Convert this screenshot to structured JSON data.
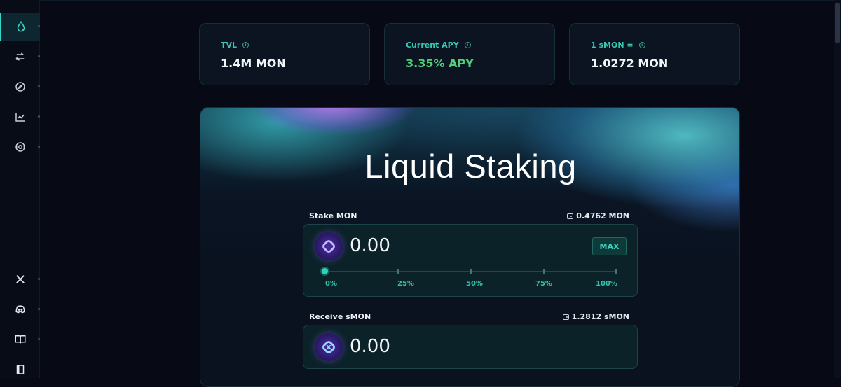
{
  "sidebar": {
    "items": [
      {
        "icon": "droplet-icon",
        "active": true
      },
      {
        "icon": "swap-icon",
        "active": false
      },
      {
        "icon": "compass-icon",
        "active": false
      },
      {
        "icon": "chart-line-icon",
        "active": false
      },
      {
        "icon": "eye-icon",
        "active": false
      }
    ],
    "footer": [
      {
        "icon": "x-icon"
      },
      {
        "icon": "discord-icon"
      },
      {
        "icon": "book-icon"
      },
      {
        "icon": "document-icon"
      }
    ]
  },
  "stats": [
    {
      "label": "TVL",
      "value": "1.4M MON",
      "color": "#f2f5f8"
    },
    {
      "label": "Current APY",
      "value": "3.35% APY",
      "color": "#4fd07a"
    },
    {
      "label": "1 sMON =",
      "value": "1.0272 MON",
      "color": "#f2f5f8"
    }
  ],
  "main": {
    "title": "Liquid Staking",
    "stake": {
      "label": "Stake MON",
      "balance": "0.4762 MON",
      "amount": "0.00",
      "max_label": "MAX",
      "slider_value": 0,
      "slider_labels": [
        "0%",
        "25%",
        "50%",
        "75%",
        "100%"
      ]
    },
    "receive": {
      "label": "Receive sMON",
      "balance": "1.2812 sMON",
      "amount": "0.00"
    }
  },
  "colors": {
    "accent": "#35d6c8",
    "apy_green": "#4fd07a",
    "background": "#070a14"
  }
}
